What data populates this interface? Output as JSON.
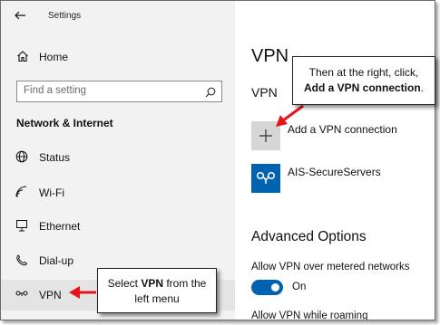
{
  "window": {
    "title": "Settings"
  },
  "sidebar": {
    "home_label": "Home",
    "search_placeholder": "Find a setting",
    "section_title": "Network & Internet",
    "items": [
      {
        "label": "Status",
        "icon": "globe-icon"
      },
      {
        "label": "Wi-Fi",
        "icon": "wifi-icon"
      },
      {
        "label": "Ethernet",
        "icon": "ethernet-icon"
      },
      {
        "label": "Dial-up",
        "icon": "dialup-icon"
      },
      {
        "label": "VPN",
        "icon": "vpn-icon",
        "active": true
      }
    ]
  },
  "content": {
    "page_title": "VPN",
    "sub_title": "VPN",
    "add_label": "Add a VPN connection",
    "connections": [
      {
        "name": "AIS-SecureServers"
      }
    ],
    "advanced_title": "Advanced Options",
    "metered_label": "Allow VPN over metered networks",
    "metered_state": "On",
    "roaming_label": "Allow VPN while roaming"
  },
  "callouts": {
    "right": {
      "line1": "Then at the right, click,",
      "bold": "Add a VPN connection",
      "tail": "."
    },
    "left": {
      "pre": "Select ",
      "bold": "VPN",
      "post": " from the",
      "line2": "left menu"
    }
  },
  "colors": {
    "accent": "#0063b1",
    "arrow": "#e8131a",
    "sidebar_bg": "#f2f2f2"
  }
}
